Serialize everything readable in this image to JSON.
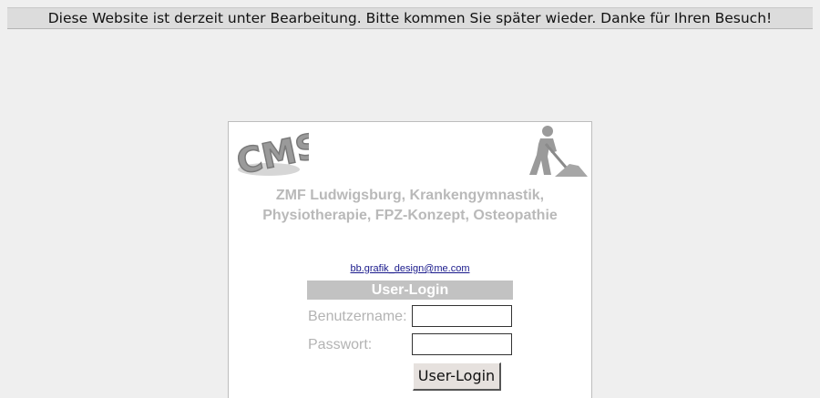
{
  "banner": {
    "message": "Diese Website ist derzeit unter Bearbeitung. Bitte kommen Sie später wieder. Danke für Ihren Besuch!"
  },
  "panel": {
    "logo_text": "CMS",
    "title_line1": "ZMF Ludwigsburg, Krankengymnastik,",
    "title_line2": "Physiotherapie, FPZ-Konzept, Osteopathie",
    "contact_email": "bb.grafik_design@me.com",
    "icons": {
      "logo": "cms-logo-icon",
      "construction": "construction-worker-icon"
    }
  },
  "login": {
    "header": "User-Login",
    "username_label": "Benutzername:",
    "username_value": "",
    "password_label": "Passwort:",
    "password_value": "",
    "submit_label": "User-Login"
  },
  "colors": {
    "background": "#efefef",
    "banner_bg": "#dcdcdc",
    "title_text": "#b9b9b9",
    "login_header_bg": "#c2c2c2",
    "link": "#1a1a8c"
  }
}
